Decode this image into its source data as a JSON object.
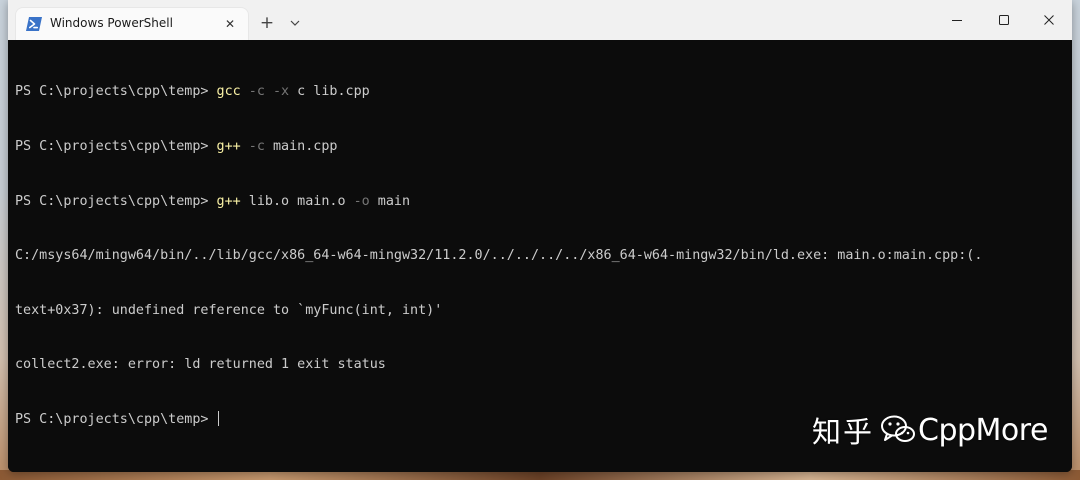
{
  "window": {
    "tab_title": "Windows PowerShell",
    "tab_close_glyph": "✕",
    "new_tab_glyph": "+",
    "dropdown_icon": "chevron-down-icon",
    "controls": [
      "minimize-icon",
      "maximize-icon",
      "close-icon"
    ]
  },
  "terminal": {
    "prompt": "PS C:\\projects\\cpp\\temp> ",
    "history": [
      {
        "cmd": "gcc",
        "flag1": "-c",
        "flag2": "-x",
        "rest": " c lib.cpp"
      },
      {
        "cmd": "g++",
        "flag1": "-c",
        "rest": " main.cpp"
      },
      {
        "cmd": "g++",
        "mid": " lib.o main.o ",
        "flag1": "-o",
        "rest": " main"
      }
    ],
    "output": [
      "C:/msys64/mingw64/bin/../lib/gcc/x86_64-w64-mingw32/11.2.0/../../../../x86_64-w64-mingw32/bin/ld.exe: main.o:main.cpp:(.",
      "text+0x37): undefined reference to `myFunc(int, int)'",
      "collect2.exe: error: ld returned 1 exit status"
    ]
  },
  "watermark": {
    "site": "知乎",
    "name": "CppMore",
    "logo_icon": "wechat-icon"
  },
  "colors": {
    "terminal_bg": "#0c0c0c",
    "text": "#cccccc",
    "command": "#f9f1a5",
    "parameter": "#767676",
    "titlebar": "#f1f1f1"
  }
}
